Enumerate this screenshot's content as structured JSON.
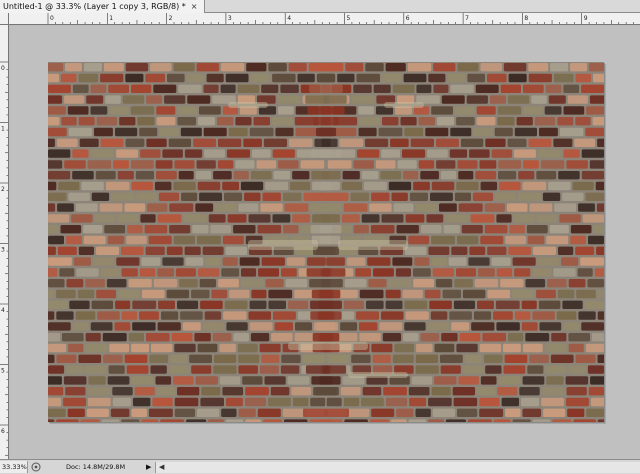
{
  "document": {
    "tab_title": "Untitled-1 @ 33.3% (Layer 1 copy 3, RGB/8) *",
    "close_glyph": "×"
  },
  "rulers": {
    "horizontal_labels": [
      "0",
      "1",
      "2",
      "3",
      "4",
      "5",
      "6",
      "7",
      "8",
      "9"
    ],
    "vertical_labels": [
      "0",
      "1",
      "2",
      "3",
      "4",
      "5",
      "6"
    ]
  },
  "status": {
    "zoom": "33.33%",
    "doc_info": "Doc: 14.8M/29.8M",
    "menu_arrow": "▶",
    "scroll_left_arrow": "◀"
  },
  "icons": {
    "status_icon": "status-info-icon",
    "close_icon": "close-icon"
  },
  "colors": {
    "pasteboard": "#c0c0c0",
    "ruler": "#f0f0f0",
    "mortar": "#8c8478",
    "brick_palette": [
      "#8a3424",
      "#a4432e",
      "#6e2f24",
      "#b8553b",
      "#5c4a3a",
      "#7a6a4a",
      "#93896b",
      "#3a2a24",
      "#c99a7c",
      "#a89f8e",
      "#4d2a22",
      "#9e5a44"
    ]
  }
}
